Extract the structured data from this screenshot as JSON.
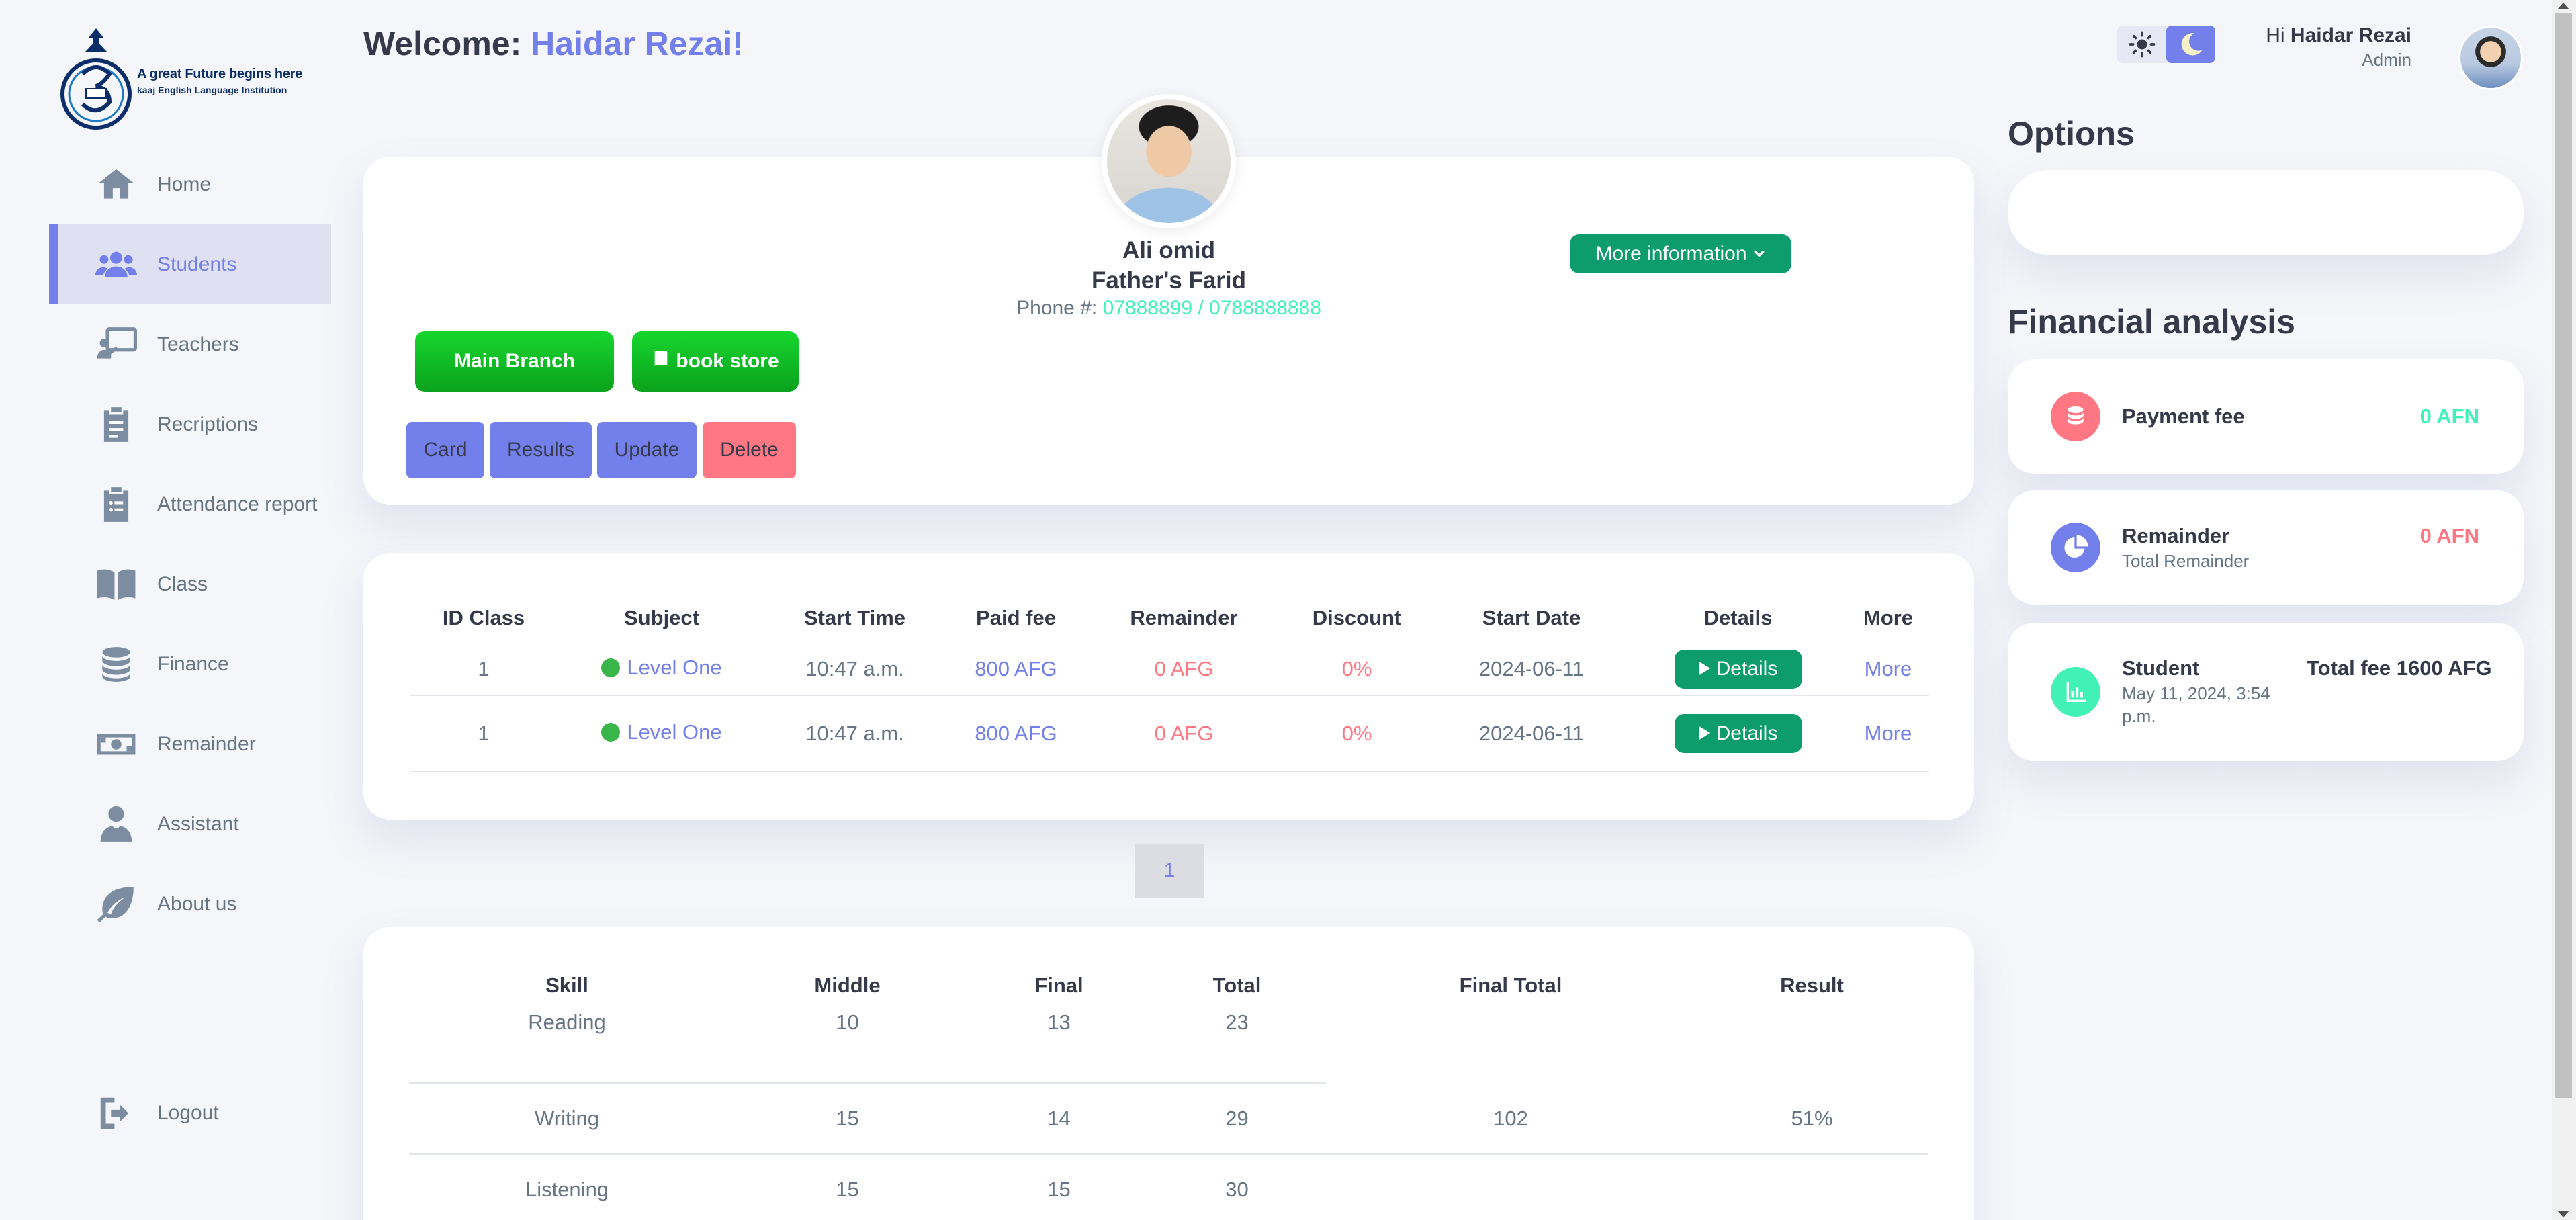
{
  "logo": {
    "tagline": "A great Future begins here",
    "institution": "kaaj English Language Institution"
  },
  "sidebar": {
    "items": [
      {
        "label": "Home",
        "icon": "home-icon"
      },
      {
        "label": "Students",
        "icon": "users-icon",
        "active": true
      },
      {
        "label": "Teachers",
        "icon": "chalkboard-teacher-icon"
      },
      {
        "label": "Recriptions",
        "icon": "clipboard-icon"
      },
      {
        "label": "Attendance report",
        "icon": "clipboard-list-icon"
      },
      {
        "label": "Class",
        "icon": "book-icon"
      },
      {
        "label": "Finance",
        "icon": "coins-icon"
      },
      {
        "label": "Remainder",
        "icon": "money-bill-icon"
      },
      {
        "label": "Assistant",
        "icon": "user-tie-icon"
      },
      {
        "label": "About us",
        "icon": "leaf-icon"
      }
    ],
    "logout": "Logout"
  },
  "header": {
    "welcome_prefix": "Welcome:",
    "welcome_name": "Haidar Rezai!",
    "hi": "Hi",
    "user_name": "Haidar Rezai",
    "role": "Admin"
  },
  "profile": {
    "name": "Ali omid",
    "father": "Father's Farid",
    "phone_label": "Phone #:",
    "phone": "07888899 / 0788888888",
    "more_info": "More information",
    "main_branch": "Main Branch",
    "book_store": "book store",
    "actions": {
      "card": "Card",
      "results": "Results",
      "update": "Update",
      "delete": "Delete"
    }
  },
  "class_table": {
    "headers": [
      "ID Class",
      "Subject",
      "Start Time",
      "Paid fee",
      "Remainder",
      "Discount",
      "Start Date",
      "Details",
      "More"
    ],
    "rows": [
      {
        "id": "1",
        "subject": "Level One",
        "start_time": "10:47 a.m.",
        "paid": "800 AFG",
        "remainder": "0 AFG",
        "discount": "0%",
        "start_date": "2024-06-11",
        "details": "Details",
        "more": "More"
      },
      {
        "id": "1",
        "subject": "Level One",
        "start_time": "10:47 a.m.",
        "paid": "800 AFG",
        "remainder": "0 AFG",
        "discount": "0%",
        "start_date": "2024-06-11",
        "details": "Details",
        "more": "More"
      }
    ]
  },
  "pagination": {
    "current": "1"
  },
  "results_table": {
    "headers": [
      "Skill",
      "Middle",
      "Final",
      "Total",
      "Final Total",
      "Result"
    ],
    "rows": [
      {
        "skill": "Reading",
        "middle": "10",
        "final": "13",
        "total": "23"
      },
      {
        "skill": "Writing",
        "middle": "15",
        "final": "14",
        "total": "29"
      },
      {
        "skill": "Listening",
        "middle": "15",
        "final": "15",
        "total": "30"
      }
    ],
    "final_total": "102",
    "result": "51%"
  },
  "right_panel": {
    "options_title": "Options",
    "financial_title": "Financial analysis",
    "payment": {
      "title": "Payment fee",
      "value": "0 AFN"
    },
    "remainder": {
      "title": "Remainder",
      "sub": "Total Remainder",
      "value": "0 AFN"
    },
    "student": {
      "title": "Student",
      "date": "May 11, 2024, 3:54 p.m.",
      "total": "Total fee 1600 AFG"
    }
  },
  "colors": {
    "primary": "#7380ec",
    "danger": "#ff7782",
    "success": "#41f1b6",
    "green_button": "#0d9c6c",
    "branch_green": "#17d62f"
  }
}
